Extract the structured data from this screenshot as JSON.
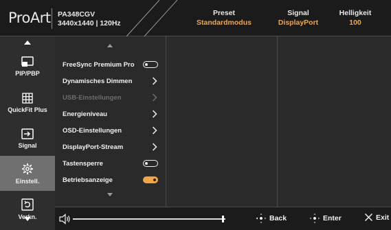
{
  "header": {
    "logo": "ProArt",
    "model": "PA348CGV",
    "resolution": "3440x1440 | 120Hz",
    "preset_label": "Preset",
    "preset_value": "Standardmodus",
    "signal_label": "Signal",
    "signal_value": "DisplayPort",
    "brightness_label": "Helligkeit",
    "brightness_value": "100",
    "accent_color": "#f0a64a"
  },
  "sidebar": {
    "items": [
      {
        "label": "PIP/PBP",
        "icon": "pip-icon"
      },
      {
        "label": "QuickFit Plus",
        "icon": "grid-icon"
      },
      {
        "label": "Signal",
        "icon": "input-icon"
      },
      {
        "label": "Einstell.",
        "icon": "gear-icon",
        "active": true
      },
      {
        "label": "Verkn.",
        "icon": "shortcut-icon"
      }
    ]
  },
  "menu": {
    "items": [
      {
        "label": "FreeSync Premium Pro",
        "control": "toggle-off"
      },
      {
        "label": "Dynamisches Dimmen",
        "control": "chevron"
      },
      {
        "label": "USB-Einstellungen",
        "control": "chevron",
        "disabled": true
      },
      {
        "label": "Energieniveau",
        "control": "chevron"
      },
      {
        "label": "OSD-Einstellungen",
        "control": "chevron"
      },
      {
        "label": "DisplayPort-Stream",
        "control": "chevron"
      },
      {
        "label": "Tastensperre",
        "control": "toggle-off"
      },
      {
        "label": "Betriebsanzeige",
        "control": "toggle-on"
      }
    ]
  },
  "footer": {
    "volume_level": 0.98,
    "back_label": "Back",
    "enter_label": "Enter",
    "exit_label": "Exit"
  }
}
